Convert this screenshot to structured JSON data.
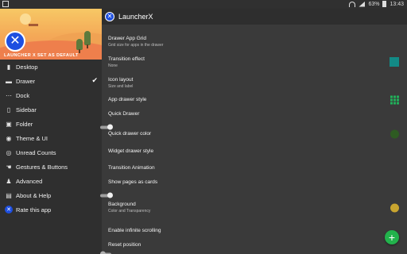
{
  "statusbar": {
    "battery": "63%",
    "time": "13:43"
  },
  "drawer": {
    "banner_caption": "LAUNCHER X SET AS DEFAULT",
    "items": [
      {
        "label": "Desktop",
        "icon": "desktop-icon",
        "glyph": "▮"
      },
      {
        "label": "Drawer",
        "icon": "drawer-icon",
        "glyph": "▬",
        "checked": true
      },
      {
        "label": "Dock",
        "icon": "dock-icon",
        "glyph": "⋯"
      },
      {
        "label": "Sidebar",
        "icon": "sidebar-icon",
        "glyph": "▯"
      },
      {
        "label": "Folder",
        "icon": "folder-icon",
        "glyph": "▣"
      },
      {
        "label": "Theme & UI",
        "icon": "palette-icon",
        "glyph": "◉"
      },
      {
        "label": "Unread Counts",
        "icon": "badge-icon",
        "glyph": "◎"
      },
      {
        "label": "Gestures & Buttons",
        "icon": "hand-icon",
        "glyph": "☚"
      },
      {
        "label": "Advanced",
        "icon": "person-icon",
        "glyph": "♟"
      },
      {
        "label": "About & Help",
        "icon": "info-icon",
        "glyph": "▤"
      },
      {
        "label": "Rate this app",
        "icon": "rate-icon",
        "glyph": "✕"
      }
    ],
    "check_glyph": "✔"
  },
  "toolbar": {
    "title": "LauncherX",
    "icon_glyph": "✕"
  },
  "settings": [
    {
      "title": "Drawer App Grid",
      "subtitle": "Grid size for apps in the drawer",
      "widget": "none"
    },
    {
      "title": "Transition effect",
      "subtitle": "None",
      "widget": "square",
      "color": "#138a86"
    },
    {
      "title": "Icon layout",
      "subtitle": "Size and label",
      "widget": "none"
    },
    {
      "title": "App drawer style",
      "subtitle": "",
      "widget": "grid"
    },
    {
      "title": "Quick Drawer",
      "subtitle": "",
      "widget": "toggle-on"
    },
    {
      "title": "Quick drawer color",
      "subtitle": "",
      "widget": "dot",
      "color": "#2e5b22"
    },
    {
      "title": "Widget drawer style",
      "subtitle": "",
      "widget": "none"
    },
    {
      "title": "Transition Animation",
      "subtitle": "",
      "widget": "none"
    },
    {
      "title": "Show pages as cards",
      "subtitle": "",
      "widget": "toggle-on"
    },
    {
      "title": "Background",
      "subtitle": "Color and Transparency",
      "widget": "dot",
      "color": "#c9a52f"
    },
    {
      "title": "Enable infinite scrolling",
      "subtitle": "",
      "widget": "none"
    },
    {
      "title": "Reset position",
      "subtitle": "",
      "widget": "toggle-off"
    }
  ],
  "fab": {
    "glyph": "+"
  },
  "colors": {
    "accent": "#1e4fe0",
    "fab": "#22b24c",
    "background": "#3a3a3a",
    "drawer": "#2f2f2f"
  }
}
